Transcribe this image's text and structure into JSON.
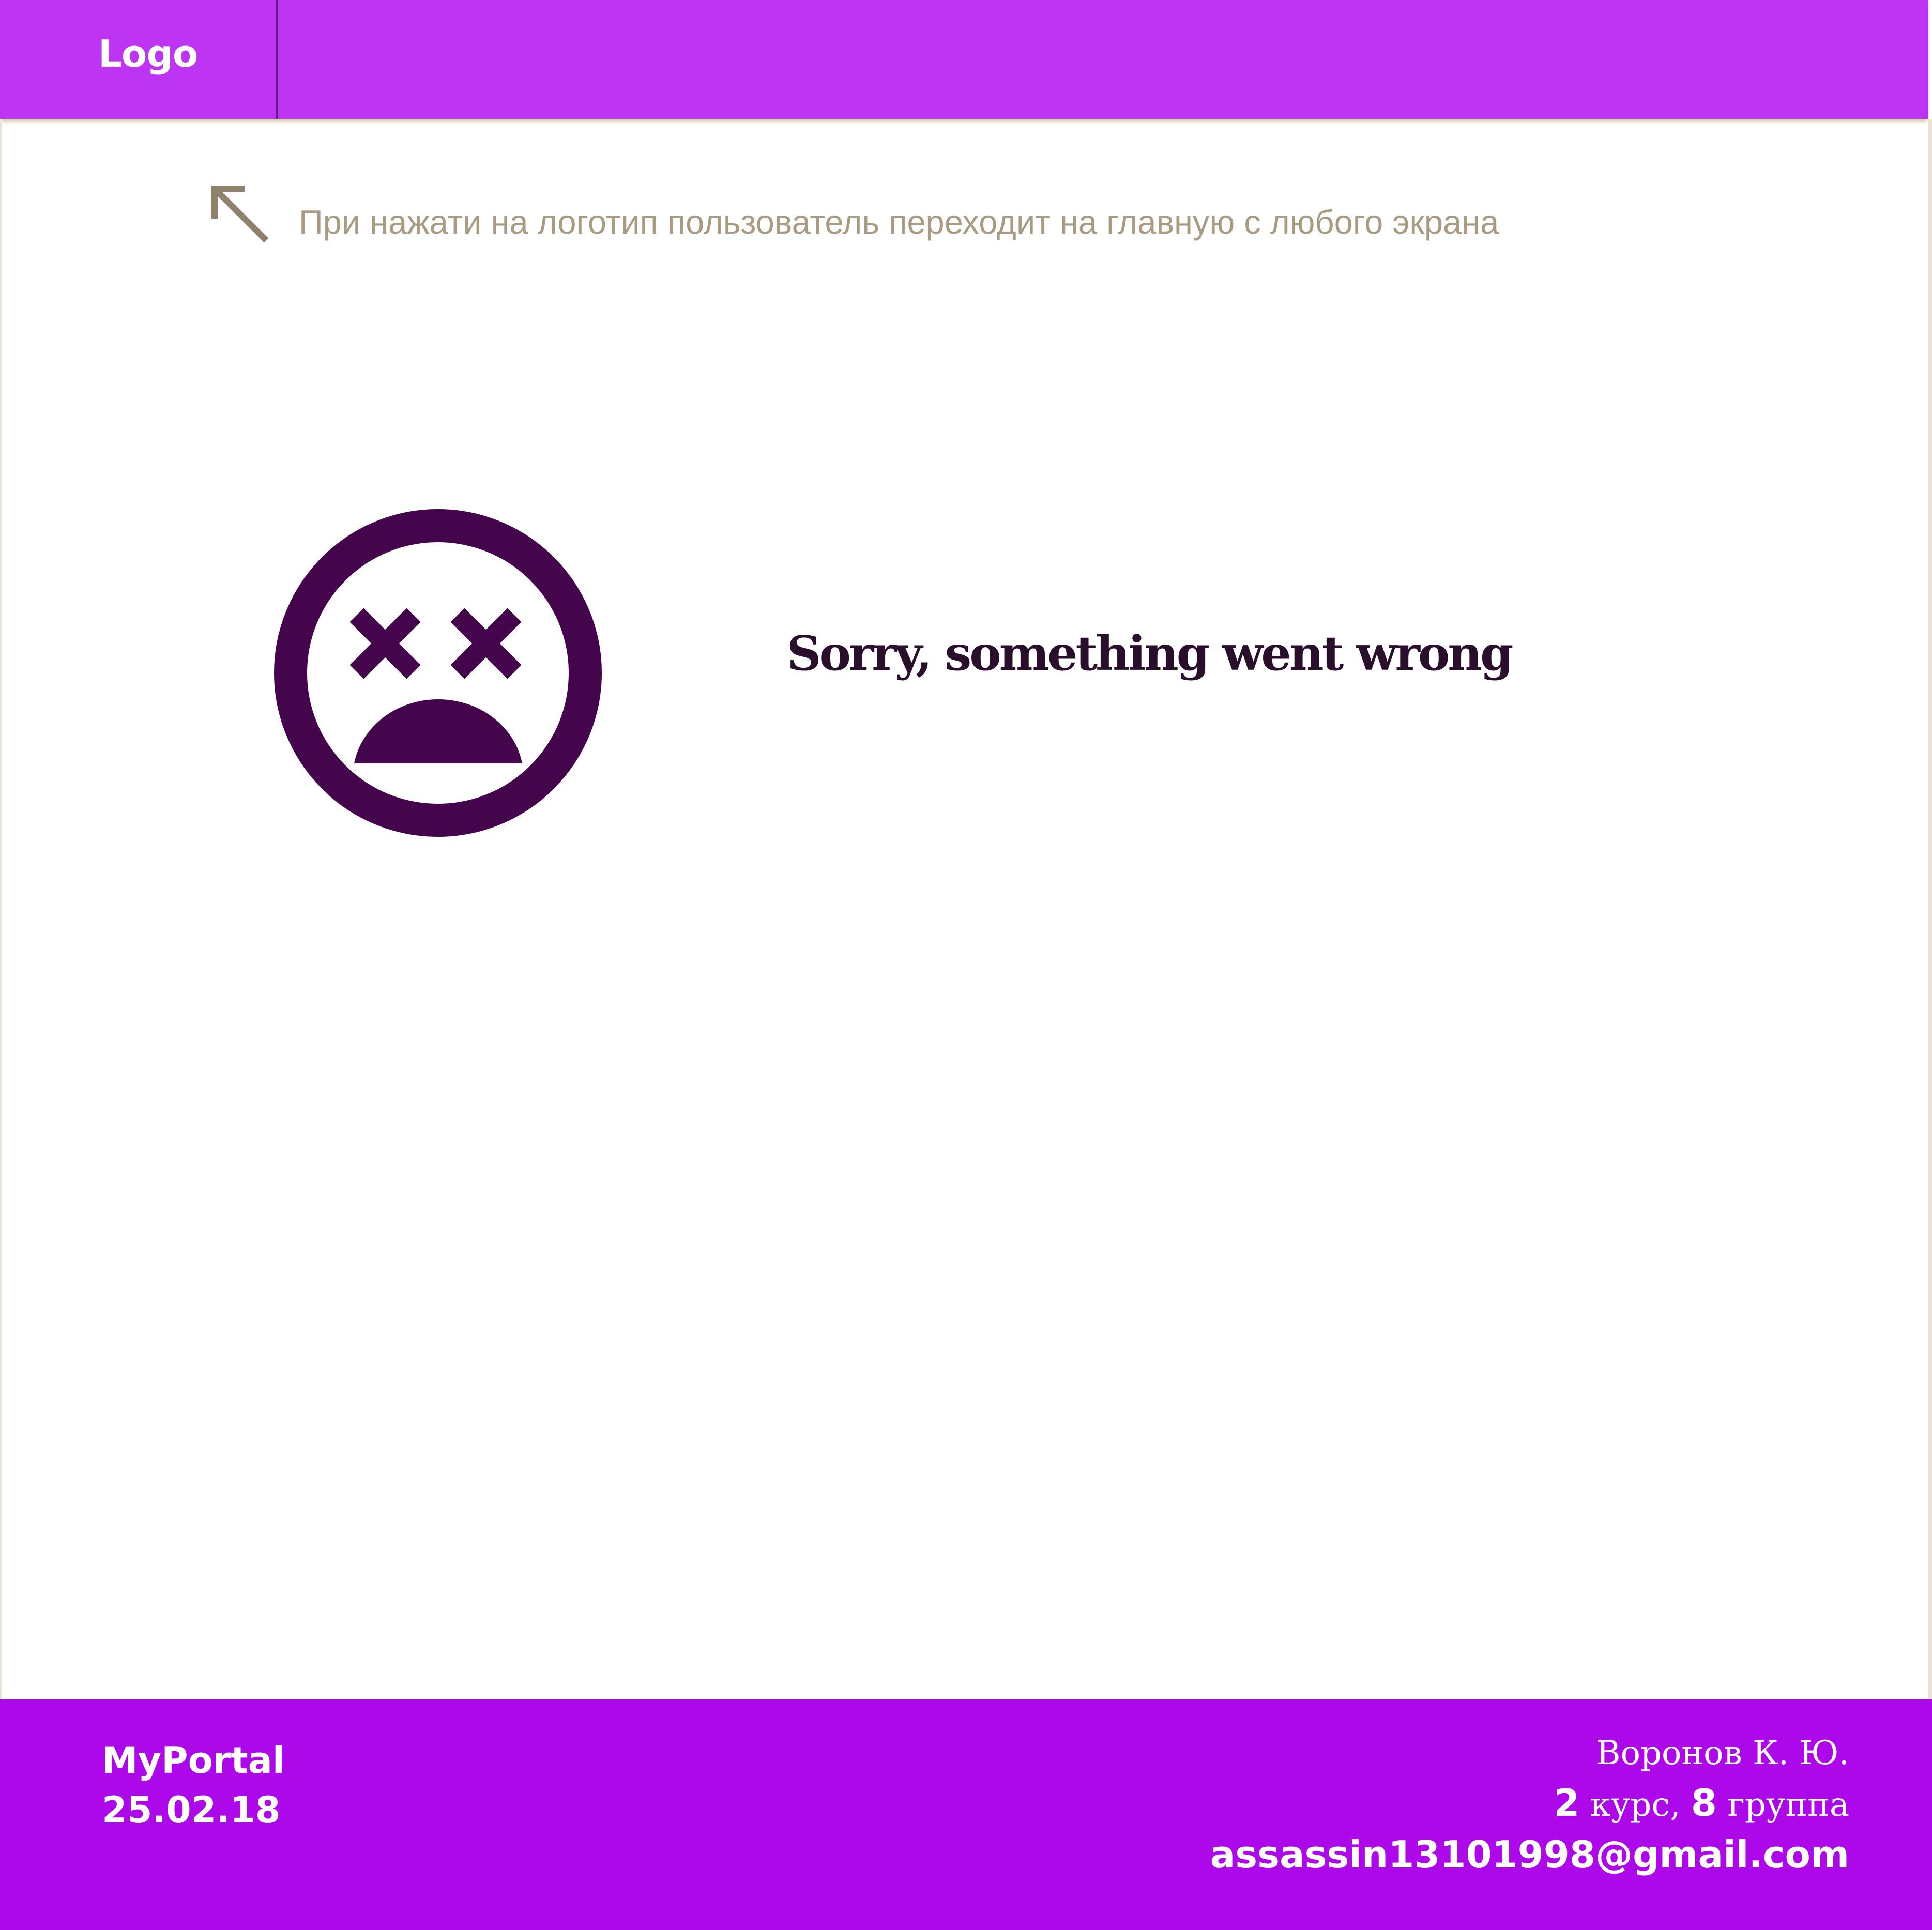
{
  "header": {
    "logo_label": "Logo"
  },
  "hint": {
    "text": "При нажати на логотип пользователь переходит на главную с любого экрана",
    "icon": "arrow-up-left-icon"
  },
  "error": {
    "icon": "dead-face-icon",
    "title": "Sorry, something went wrong"
  },
  "footer": {
    "site_name": "MyPortal",
    "date": "25.02.18",
    "author_name": "Воронов К. Ю.",
    "course_number": "2",
    "course_word": "курс,",
    "group_number": "8",
    "group_word": "группа",
    "email": "assassin13101998@gmail.com"
  },
  "colors": {
    "header_bg": "#bd35f2",
    "footer_bg": "#ad08ea",
    "face": "#44054d",
    "hint_text": "#a89b82",
    "title_text": "#2a0f2d"
  }
}
